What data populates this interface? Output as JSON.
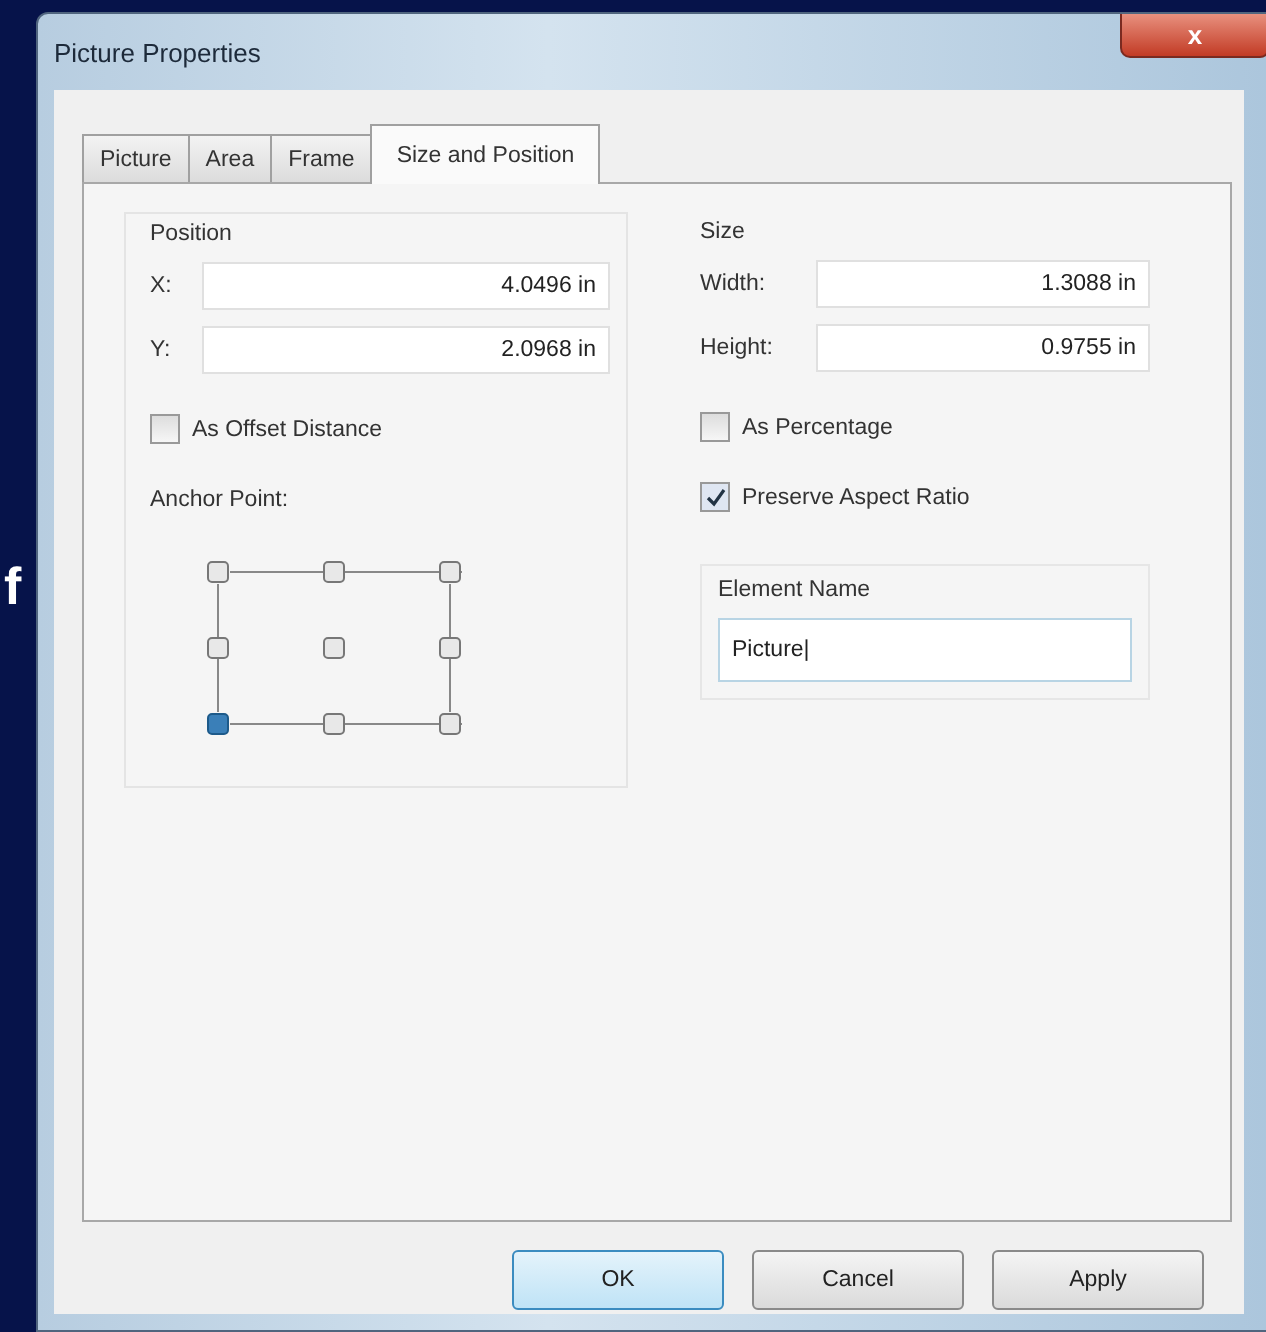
{
  "background_text": "f",
  "window": {
    "title": "Picture Properties",
    "close": "x"
  },
  "tabs": [
    {
      "label": "Picture",
      "selected": false
    },
    {
      "label": "Area",
      "selected": false
    },
    {
      "label": "Frame",
      "selected": false
    },
    {
      "label": "Size and Position",
      "selected": true
    }
  ],
  "position": {
    "label": "Position",
    "fields": [
      {
        "label": "X:",
        "value": "4.0496 in"
      },
      {
        "label": "Y:",
        "value": "2.0968 in"
      }
    ],
    "offset": {
      "label": "As Offset Distance",
      "checked": false
    },
    "anchor_label": "Anchor Point:",
    "anchors": [
      {
        "selected": false
      },
      {
        "selected": false
      },
      {
        "selected": false
      },
      {
        "selected": false
      },
      {
        "selected": false
      },
      {
        "selected": false
      },
      {
        "selected": true
      },
      {
        "selected": false
      },
      {
        "selected": false
      }
    ]
  },
  "size": {
    "label": "Size",
    "fields": [
      {
        "label": "Width:",
        "value": "1.3088 in"
      },
      {
        "label": "Height:",
        "value": "0.9755 in"
      }
    ],
    "checks": [
      {
        "label": "As Percentage",
        "checked": false
      },
      {
        "label": "Preserve Aspect Ratio",
        "checked": true
      }
    ]
  },
  "element_name": {
    "label": "Element Name",
    "value": "Picture|"
  },
  "buttons": [
    {
      "label": "OK",
      "default": true
    },
    {
      "label": "Cancel",
      "default": false
    },
    {
      "label": "Apply",
      "default": false
    }
  ]
}
